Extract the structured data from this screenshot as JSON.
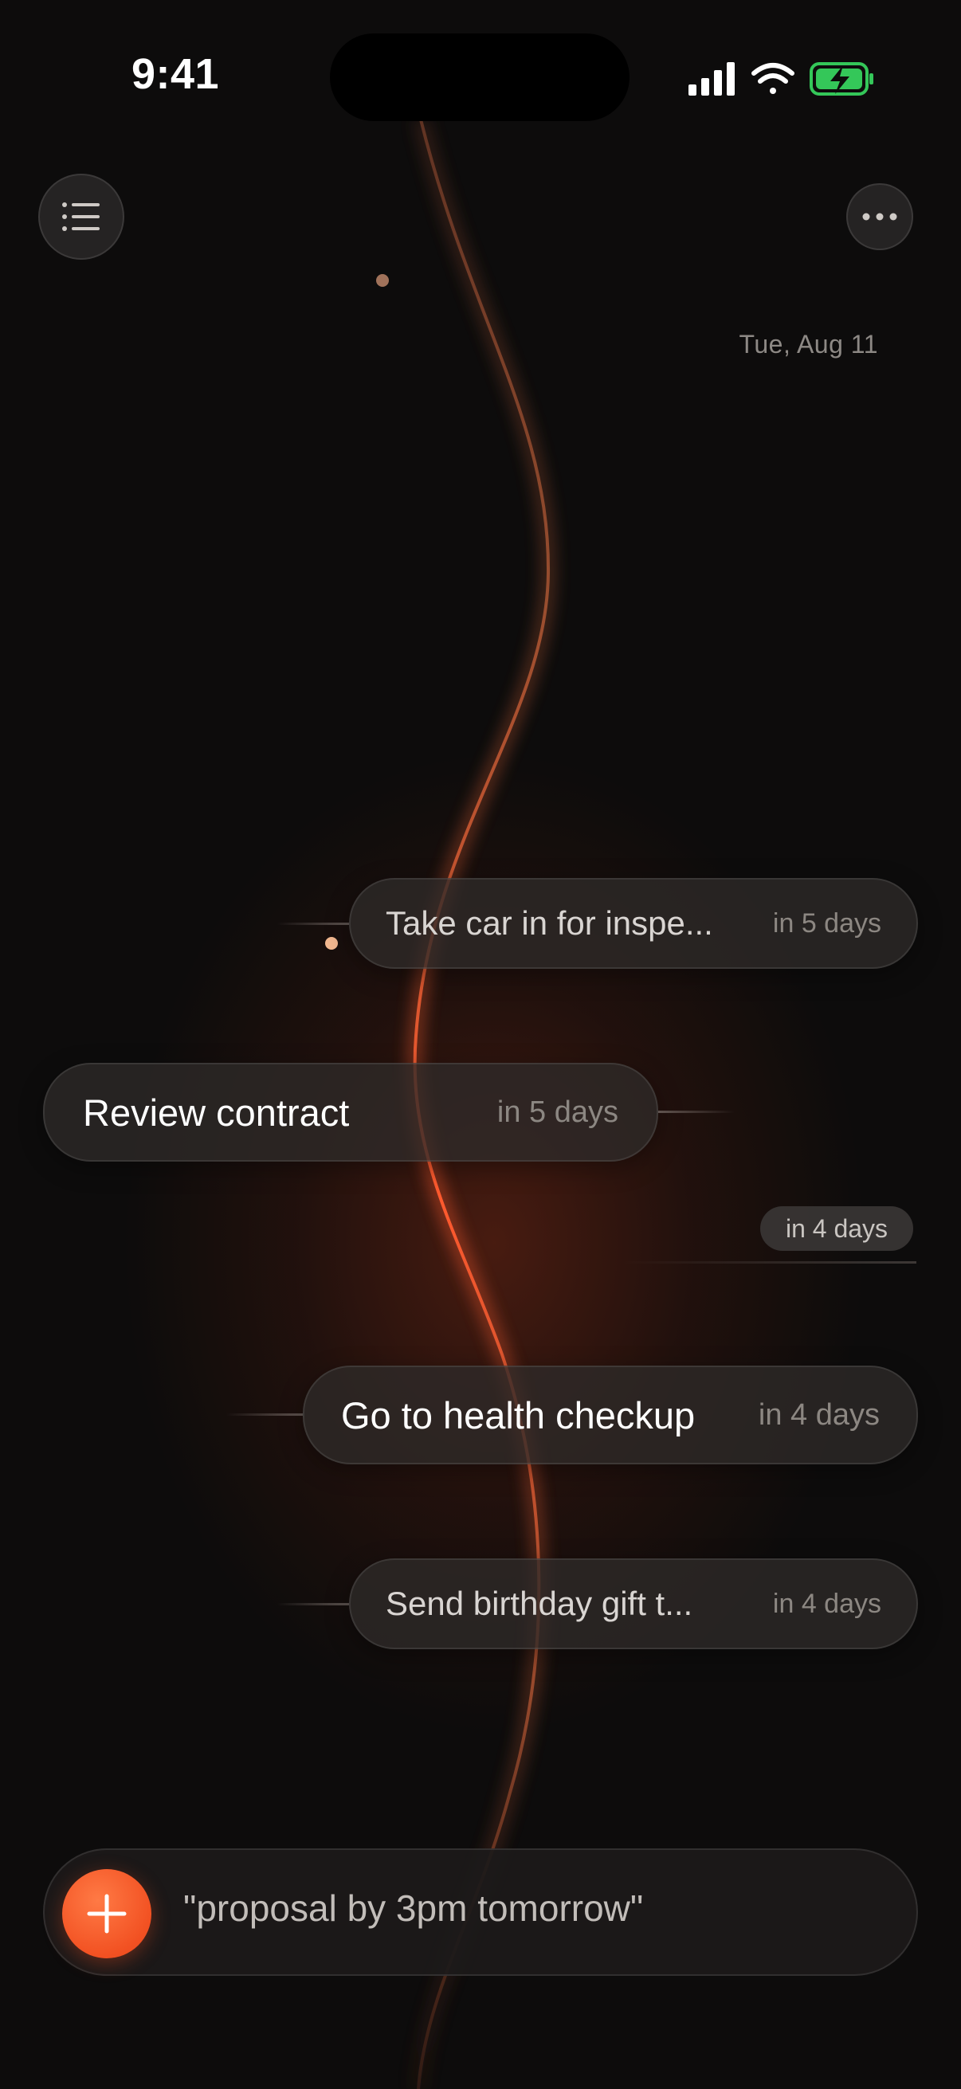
{
  "status_bar": {
    "time": "9:41"
  },
  "header": {
    "date": "Tue, Aug 11"
  },
  "tasks": [
    {
      "title": "Take car in for inspe...",
      "due": "in 5 days"
    },
    {
      "title": "Review contract",
      "due": "in 5 days"
    },
    {
      "title": "Go to health checkup",
      "due": "in 4 days"
    },
    {
      "title": "Send birthday gift t...",
      "due": "in 4 days"
    }
  ],
  "day_marker": "in 4 days",
  "input": {
    "placeholder": "\"proposal by 3pm tomorrow\""
  },
  "colors": {
    "accent": "#F25122",
    "thread": "#E0643A",
    "background": "#0D0C0C",
    "battery": "#34C759"
  },
  "icons": [
    "list-icon",
    "more-icon",
    "plus-icon",
    "signal-icon",
    "wifi-icon",
    "battery-charging-icon"
  ]
}
